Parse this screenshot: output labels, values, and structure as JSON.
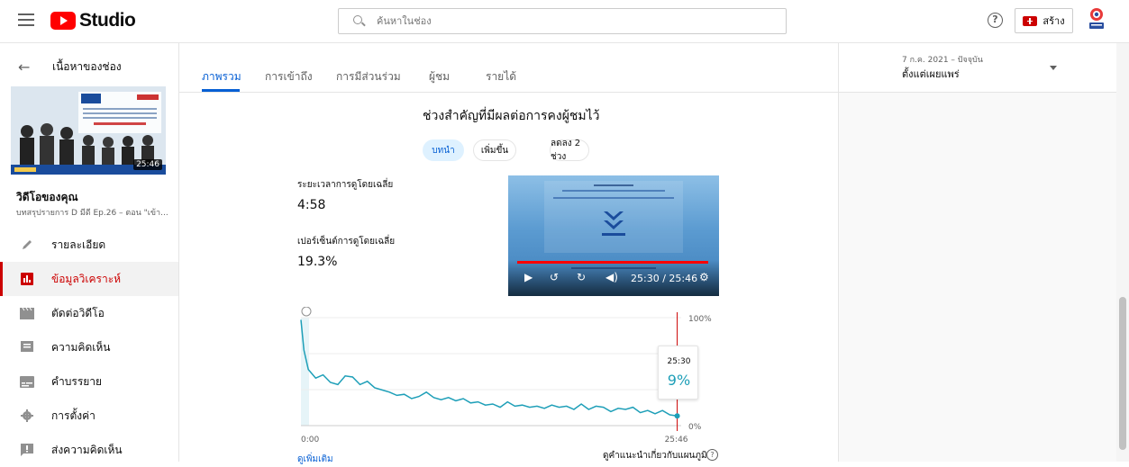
{
  "app": {
    "brand": "Studio",
    "brand_color": "#ff0000"
  },
  "header": {
    "search_placeholder": "ค้นหาในช่อง",
    "create_label": "สร้าง",
    "help_symbol": "?"
  },
  "sidebar": {
    "back_label": "เนื้อหาของช่อง",
    "thumbnail_duration": "25:46",
    "video_title": "วิดีโอของคุณ",
    "video_subtitle": "บทสรุปรายการ D มีดี Ep.26 – ตอน \"เข้า...",
    "items": [
      {
        "label": "รายละเอียด",
        "icon": "pencil-icon",
        "active": false
      },
      {
        "label": "ข้อมูลวิเคราะห์",
        "icon": "analytics-icon",
        "active": true
      },
      {
        "label": "ตัดต่อวิดีโอ",
        "icon": "clapperboard-icon",
        "active": false
      },
      {
        "label": "ความคิดเห็น",
        "icon": "comment-icon",
        "active": false
      },
      {
        "label": "คำบรรยาย",
        "icon": "subtitles-icon",
        "active": false
      },
      {
        "label": "การตั้งค่า",
        "icon": "gear-icon",
        "active": false
      },
      {
        "label": "ส่งความคิดเห็น",
        "icon": "feedback-icon",
        "active": false
      }
    ]
  },
  "tabs": [
    {
      "label": "ภาพรวม",
      "active": true
    },
    {
      "label": "การเข้าถึง",
      "active": false
    },
    {
      "label": "การมีส่วนร่วม",
      "active": false
    },
    {
      "label": "ผู้ชม",
      "active": false
    },
    {
      "label": "รายได้",
      "active": false
    }
  ],
  "date_filter": {
    "range": "7 ก.ค. 2021 – ปัจจุบัน",
    "label": "ตั้งแต่เผยแพร่"
  },
  "retention": {
    "title": "ช่วงสำคัญที่มีผลต่อการคงผู้ชมไว้",
    "chips": [
      "บทนำ",
      "เพิ่มขึ้น",
      "ลดลง 2 ช่วง"
    ],
    "avg_duration_label": "ระยะเวลาการดูโดยเฉลี่ย",
    "avg_duration_value": "4:58",
    "avg_percent_label": "เปอร์เซ็นต์การดูโดยเฉลี่ย",
    "avg_percent_value": "19.3%",
    "player_time": "25:30 / 25:46",
    "player_progress": 0.99,
    "tooltip_time": "25:30",
    "tooltip_value": "9%",
    "more_link": "ดูเพิ่มเติม",
    "hint": "ดูคำแนะนำเกี่ยวกับแผนภูมิ"
  },
  "chart_data": {
    "type": "line",
    "x_start_label": "0:00",
    "x_end_label": "25:46",
    "y_tick_labels": [
      "100%",
      "%",
      "%",
      "0%"
    ],
    "color": "#1e9fb8",
    "x_minutes": [
      0,
      0.2,
      0.5,
      1,
      1.5,
      2,
      2.5,
      3,
      3.5,
      4,
      4.5,
      5,
      5.5,
      6,
      6.5,
      7,
      7.5,
      8,
      8.5,
      9,
      9.5,
      10,
      10.5,
      11,
      11.5,
      12,
      12.5,
      13,
      13.5,
      14,
      14.5,
      15,
      15.5,
      16,
      16.5,
      17,
      17.5,
      18,
      18.5,
      19,
      19.5,
      20,
      20.5,
      21,
      21.5,
      22,
      22.5,
      23,
      23.5,
      24,
      24.5,
      25,
      25.5
    ],
    "y_percent": [
      98,
      70,
      52,
      44,
      47,
      40,
      38,
      46,
      45,
      38,
      41,
      35,
      33,
      31,
      28,
      29,
      25,
      27,
      31,
      26,
      24,
      26,
      23,
      25,
      21,
      22,
      19,
      20,
      17,
      22,
      18,
      19,
      17,
      18,
      16,
      19,
      17,
      18,
      15,
      20,
      15,
      18,
      17,
      13,
      16,
      15,
      17,
      12,
      14,
      11,
      14,
      10,
      9
    ]
  }
}
